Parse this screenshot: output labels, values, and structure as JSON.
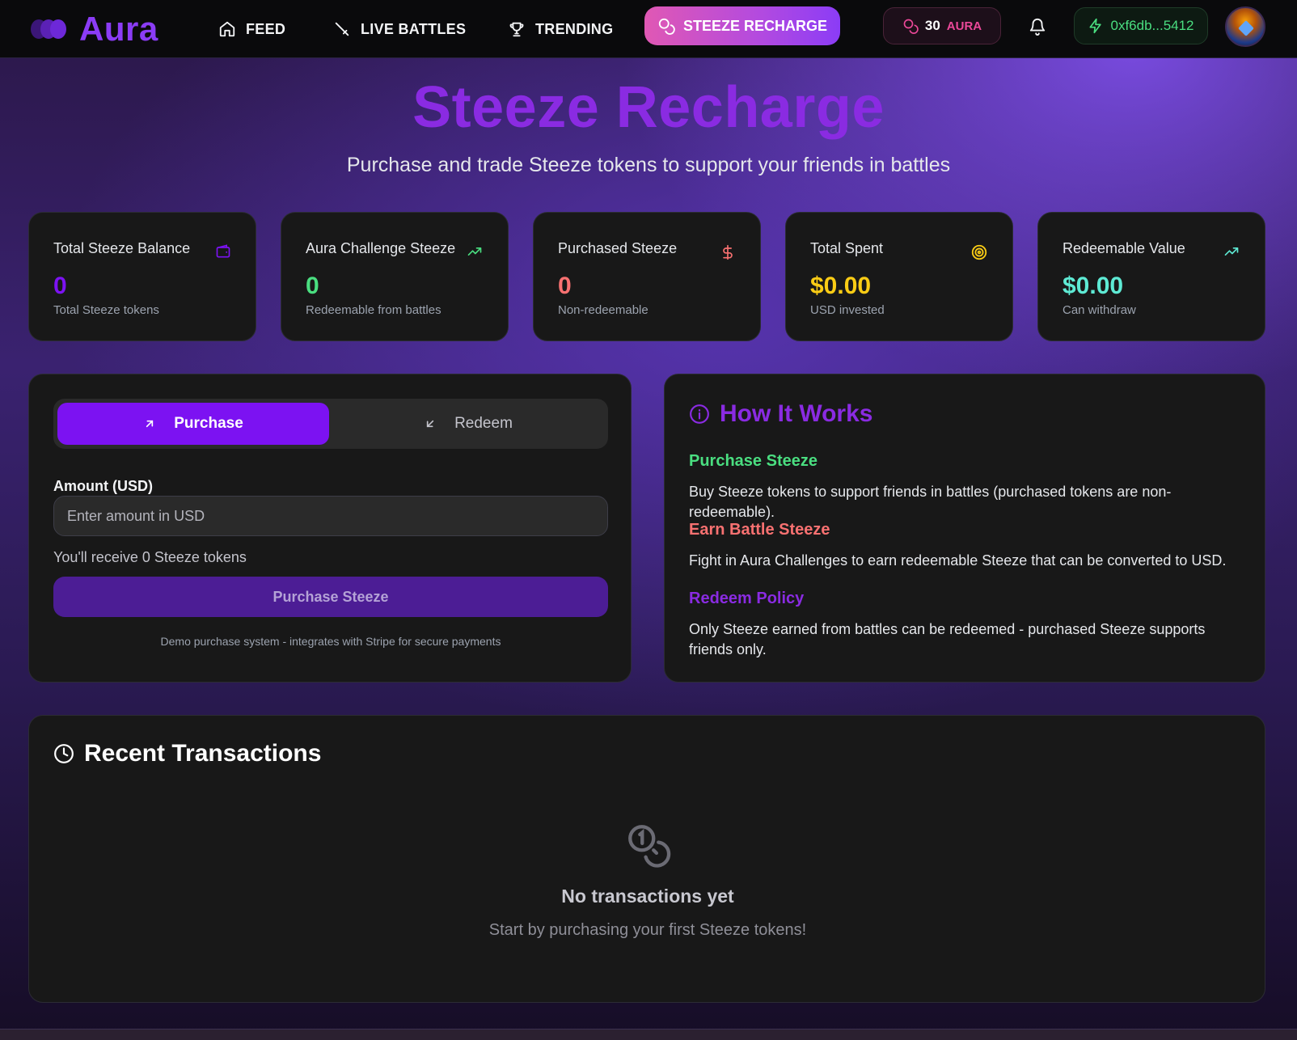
{
  "app": {
    "name": "Aura"
  },
  "nav": {
    "feed": "FEED",
    "live_battles": "LIVE BATTLES",
    "trending": "TRENDING",
    "steeze_recharge": "STEEZE RECHARGE"
  },
  "aura_balance": {
    "count": "30",
    "label": "AURA"
  },
  "wallet": {
    "address": "0xf6db...5412"
  },
  "hero": {
    "title": "Steeze Recharge",
    "subtitle": "Purchase and trade Steeze tokens to support your friends in battles"
  },
  "stats": [
    {
      "label": "Total Steeze Balance",
      "value": "0",
      "sub": "Total Steeze tokens",
      "icon": "wallet-icon",
      "color": "#7c12f2"
    },
    {
      "label": "Aura Challenge Steeze",
      "value": "0",
      "sub": "Redeemable from battles",
      "icon": "trending-up-icon",
      "color": "#4ade80"
    },
    {
      "label": "Purchased Steeze",
      "value": "0",
      "sub": "Non-redeemable",
      "icon": "dollar-icon",
      "color": "#f87171"
    },
    {
      "label": "Total Spent",
      "value": "$0.00",
      "sub": "USD invested",
      "icon": "target-icon",
      "color": "#facc15"
    },
    {
      "label": "Redeemable Value",
      "value": "$0.00",
      "sub": "Can withdraw",
      "icon": "trending-up-icon",
      "color": "#5eead4"
    }
  ],
  "trade": {
    "tab_purchase": "Purchase",
    "tab_redeem": "Redeem",
    "amount_label": "Amount (USD)",
    "amount_placeholder": "Enter amount in USD",
    "amount_value": "",
    "receive_text": "You'll receive 0 Steeze tokens",
    "purchase_button": "Purchase Steeze",
    "demo_note": "Demo purchase system - integrates with Stripe for secure payments"
  },
  "how_it_works": {
    "title": "How It Works",
    "sections": [
      {
        "heading": "Purchase Steeze",
        "text": "Buy Steeze tokens to support friends in battles (purchased tokens are non-redeemable).",
        "color": "#4ade80"
      },
      {
        "heading": "Earn Battle Steeze",
        "text": "Fight in Aura Challenges to earn redeemable Steeze that can be converted to USD.",
        "color": "#f87171"
      },
      {
        "heading": "Redeem Policy",
        "text": "Only Steeze earned from battles can be redeemed - purchased Steeze supports friends only.",
        "color": "#8a2be2"
      }
    ]
  },
  "transactions": {
    "title": "Recent Transactions",
    "empty_title": "No transactions yet",
    "empty_sub": "Start by purchasing your first Steeze tokens!"
  },
  "colors": {
    "accent": "#8a2be2",
    "purchase_tab": "#7c12f2",
    "nav_active_gradient": [
      "#e058b4",
      "#8b3cf6"
    ],
    "wallet_green": "#4ade80",
    "aura_pink": "#ec4899"
  }
}
